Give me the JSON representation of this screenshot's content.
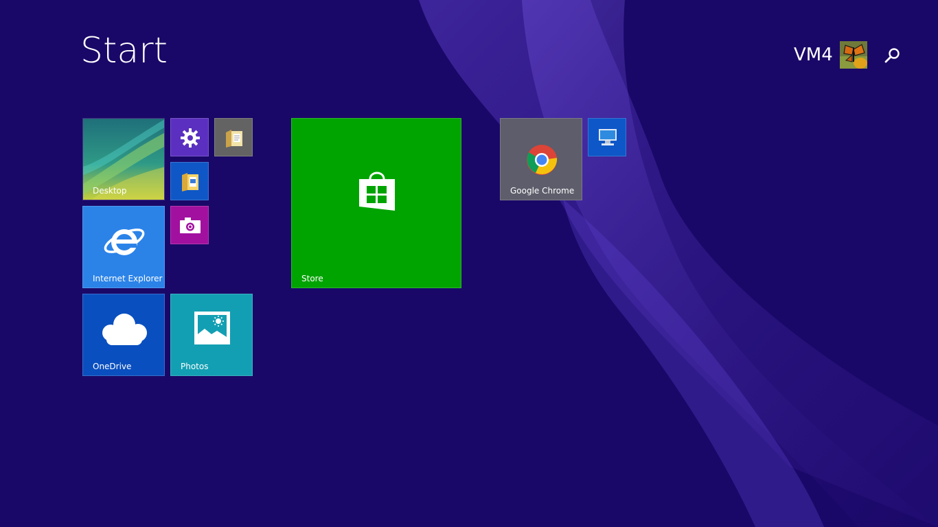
{
  "screen": {
    "title": "Start"
  },
  "user": {
    "name": "VM4",
    "avatar_icon": "butterfly-avatar"
  },
  "search": {
    "icon": "search-icon"
  },
  "colors": {
    "background": "#1a0868",
    "store": "#00a400",
    "internet_explorer": "#2b83e8",
    "onedrive": "#0a4fbf",
    "photos": "#139fb3",
    "settings": "#5b2fbf",
    "camera": "#a2109f",
    "file_explorer": "#0f57c6",
    "chrome_tile": "#5d5d6b",
    "folder_tile": "#636363",
    "this_pc": "#0d57c8"
  },
  "tiles": {
    "desktop": {
      "label": "Desktop",
      "icon": "desktop-wallpaper"
    },
    "settings": {
      "label": "",
      "icon": "gear-icon"
    },
    "folder": {
      "label": "",
      "icon": "folder-icon"
    },
    "file_explorer": {
      "label": "",
      "icon": "file-explorer-icon"
    },
    "camera": {
      "label": "",
      "icon": "camera-icon"
    },
    "internet_explorer": {
      "label": "Internet Explorer",
      "icon": "internet-explorer-icon"
    },
    "onedrive": {
      "label": "OneDrive",
      "icon": "cloud-icon"
    },
    "photos": {
      "label": "Photos",
      "icon": "photo-icon"
    },
    "store": {
      "label": "Store",
      "icon": "store-bag-icon"
    },
    "chrome": {
      "label": "Google Chrome",
      "icon": "chrome-icon"
    },
    "this_pc": {
      "label": "",
      "icon": "computer-icon"
    }
  }
}
